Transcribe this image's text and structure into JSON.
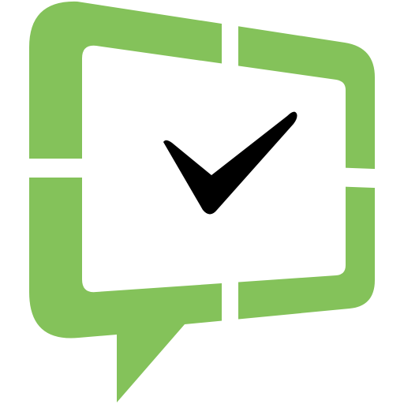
{
  "icon": {
    "name": "chat-bubble-checkmark-icon",
    "bubble_name": "speech-bubble-icon",
    "check_name": "checkmark-icon"
  },
  "colors": {
    "background": "#ffffff",
    "bubble_green": "#84c25a",
    "bubble_inner": "#ffffff",
    "check": "#000000"
  }
}
